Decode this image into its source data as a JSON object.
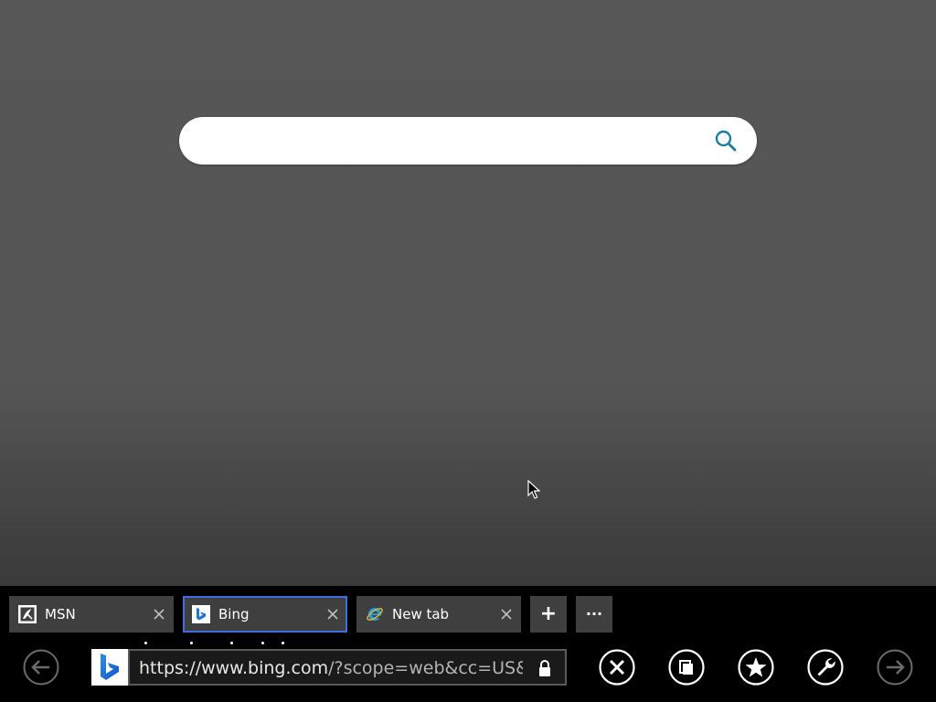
{
  "page": {
    "search": {
      "value": "",
      "placeholder": "",
      "icon": "search-icon",
      "accent_color": "#1a7f9c"
    }
  },
  "tabs": [
    {
      "label": "MSN",
      "favicon": "msn-favicon-icon",
      "active": false
    },
    {
      "label": "Bing",
      "favicon": "bing-favicon-icon",
      "active": true
    },
    {
      "label": "New tab",
      "favicon": "ie-favicon-icon",
      "active": false
    }
  ],
  "tab_bar": {
    "new_tab_symbol": "+",
    "more_symbol": "···"
  },
  "address": {
    "url_main": "https://www.bing.com",
    "url_rest": "/?scope=web&cc=US&",
    "secure_icon": "lock-icon"
  },
  "nav": {
    "back_icon": "back-arrow-icon",
    "stop_icon": "close-circle-icon",
    "tabs_icon": "tabs-icon",
    "favorites_icon": "star-icon",
    "tools_icon": "wrench-icon",
    "forward_icon": "forward-arrow-icon"
  },
  "colors": {
    "appbar_bg": "#000000",
    "tab_bg": "#3f3f3f",
    "active_tab_border": "#3c6fe0",
    "page_bg": "#575757"
  }
}
